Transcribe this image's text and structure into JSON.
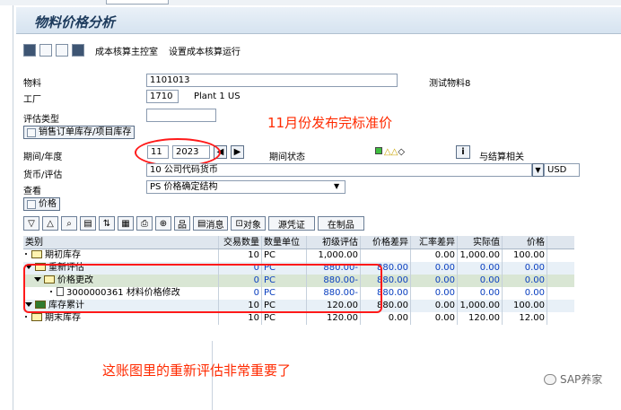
{
  "title": "物料价格分析",
  "app_toolbar": {
    "cockpit_label": "成本核算主控室",
    "set_run_label": "设置成本核算运行"
  },
  "form": {
    "material_label": "物料",
    "material_value": "1101013",
    "material_desc": "测试物料8",
    "plant_label": "工厂",
    "plant_value": "1710",
    "plant_desc": "Plant 1 US",
    "valuation_type_label": "评估类型",
    "valuation_type_value": "",
    "sales_order_button": "销售订单库存/项目库存",
    "period_label": "期间/年度",
    "period_value": "11",
    "year_value": "2023",
    "period_status_label": "期间状态",
    "fin_relevant_label": "与结算相关",
    "currency_label": "货币/评估",
    "currency_value": "10 公司代码货币",
    "currency_code": "USD",
    "view_label": "查看",
    "view_value": "PS 价格确定结构",
    "price_button": "价格"
  },
  "grid_toolbar": {
    "message_label": "消息",
    "object_label": "对象",
    "source_doc_label": "源凭证",
    "wip_label": "在制品"
  },
  "grid": {
    "columns": [
      "类别",
      "交易数量",
      "数量单位",
      "初级评估",
      "价格差异",
      "汇率差异",
      "实际值",
      "价格"
    ],
    "rows": [
      {
        "name": "期初库存",
        "qty": "10",
        "unit": "PC",
        "prelim": "1,000.00",
        "pdiff": "",
        "erdiff": "0.00",
        "actual": "1,000.00",
        "price": "100.00"
      },
      {
        "name": "重新评估",
        "qty": "0",
        "unit": "PC",
        "prelim": "880.00-",
        "pdiff": "880.00",
        "erdiff": "0.00",
        "actual": "0.00",
        "price": "0.00"
      },
      {
        "name": "价格更改",
        "qty": "0",
        "unit": "PC",
        "prelim": "880.00-",
        "pdiff": "880.00",
        "erdiff": "0.00",
        "actual": "0.00",
        "price": "0.00"
      },
      {
        "name": "3000000361 材料价格修改",
        "qty": "0",
        "unit": "PC",
        "prelim": "880.00-",
        "pdiff": "880.00",
        "erdiff": "0.00",
        "actual": "0.00",
        "price": "0.00"
      },
      {
        "name": "库存累计",
        "qty": "10",
        "unit": "PC",
        "prelim": "120.00",
        "pdiff": "880.00",
        "erdiff": "0.00",
        "actual": "1,000.00",
        "price": "100.00"
      },
      {
        "name": "期末库存",
        "qty": "10",
        "unit": "PC",
        "prelim": "120.00",
        "pdiff": "0.00",
        "erdiff": "0.00",
        "actual": "120.00",
        "price": "12.00"
      }
    ]
  },
  "annotations": {
    "note1": "11月份发布完标准价",
    "note2": "这账图里的重新评估非常重要了"
  },
  "watermark": "SAP养家"
}
